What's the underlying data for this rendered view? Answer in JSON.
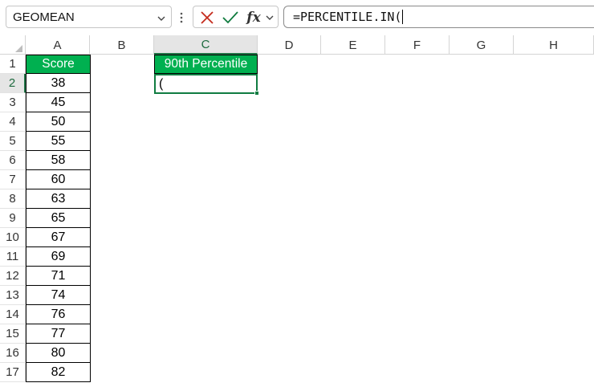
{
  "formula_bar": {
    "name_box_value": "GEOMEAN",
    "fx_label": "fx",
    "formula_text": "=PERCENTILE.IN("
  },
  "columns": [
    "A",
    "B",
    "C",
    "D",
    "E",
    "F",
    "G",
    "H"
  ],
  "active_column": "C",
  "active_row": "2",
  "rows": [
    "1",
    "2",
    "3",
    "4",
    "5",
    "6",
    "7",
    "8",
    "9",
    "10",
    "11",
    "12",
    "13",
    "14",
    "15",
    "16",
    "17"
  ],
  "table": {
    "score_header": "Score",
    "scores": [
      "38",
      "45",
      "50",
      "55",
      "58",
      "60",
      "63",
      "65",
      "67",
      "69",
      "71",
      "74",
      "76",
      "77",
      "80",
      "82"
    ],
    "percentile_header": "90th Percentile",
    "editing_cell_text": "("
  },
  "colors": {
    "header_fill": "#00b050",
    "selection": "#107c41",
    "cancel_red": "#c42b1c",
    "enter_green": "#0f7b3e"
  }
}
